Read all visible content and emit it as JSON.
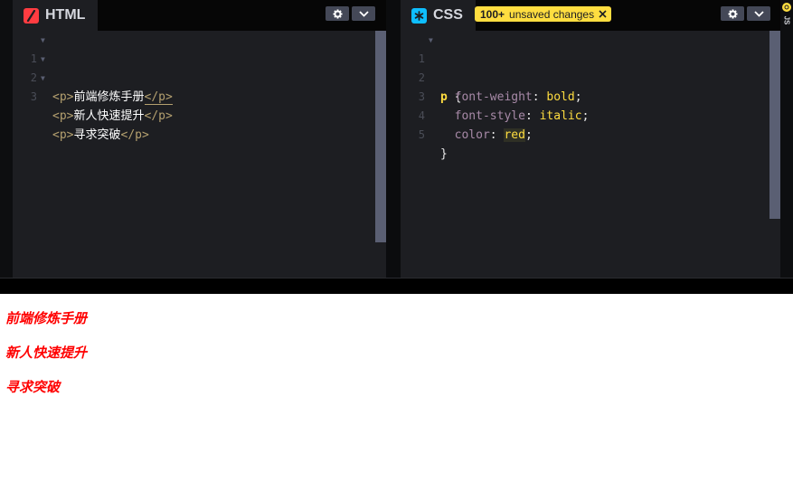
{
  "html_pane": {
    "tab_label": "HTML",
    "tab_icon": "html-slash-icon",
    "lines": [
      {
        "num": "1",
        "open": "<p>",
        "text": "前端修炼手册",
        "close": "</p>"
      },
      {
        "num": "2",
        "open": "<p>",
        "text": "新人快速提升",
        "close": "</p>"
      },
      {
        "num": "3",
        "open": "<p>",
        "text": "寻求突破",
        "close": "</p>"
      }
    ]
  },
  "css_pane": {
    "tab_label": "CSS",
    "tab_icon": "css-asterisk-icon",
    "badge": {
      "count": "100+",
      "text": "unsaved changes"
    },
    "lines": [
      {
        "num": "1",
        "selector": "p",
        "brace": "{"
      },
      {
        "num": "2",
        "prop": "font-weight",
        "value": "bold"
      },
      {
        "num": "3",
        "prop": "font-style",
        "value": "italic"
      },
      {
        "num": "4",
        "prop": "color",
        "value": "red"
      },
      {
        "num": "5",
        "brace": "}"
      }
    ]
  },
  "js_strip": {
    "label": "JS"
  },
  "preview": {
    "paragraphs": [
      "前端修炼手册",
      "新人快速提升",
      "寻求突破"
    ]
  },
  "colors": {
    "editor_bg": "#1d1e22",
    "html_accent": "#ff3c41",
    "css_accent": "#0ebeff",
    "badge": "#ffdd40",
    "preview_text": "#ff0000"
  }
}
